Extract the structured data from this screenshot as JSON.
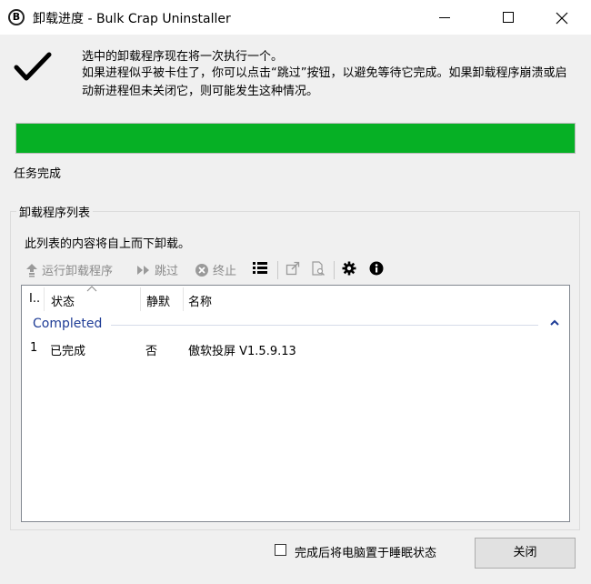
{
  "window": {
    "title": "卸载进度 - Bulk Crap Uninstaller",
    "app_icon_letter": "B"
  },
  "message": {
    "line1": "选中的卸载程序现在将一次执行一个。",
    "line2": "如果进程似乎被卡住了，你可以点击“跳过”按钮，以避免等待它完成。如果卸载程序崩溃或启动新进程但未关闭它，则可能发生这种情况。"
  },
  "progress": {
    "value_percent": 100,
    "status": "任务完成",
    "fill_color": "#06b025"
  },
  "uninstaller_group": {
    "title": "卸载程序列表",
    "description": "此列表的内容将自上而下卸载。",
    "toolbar": {
      "run_label": "运行卸载程序",
      "skip_label": "跳过",
      "stop_label": "终止"
    },
    "columns": {
      "index": "I..",
      "status": "状态",
      "quiet": "静默",
      "name": "名称"
    },
    "groups": [
      {
        "label": "Completed",
        "rows": [
          {
            "index": "1",
            "status": "已完成",
            "quiet": "否",
            "name": "傲软投屏 V1.5.9.13"
          }
        ]
      }
    ]
  },
  "footer": {
    "sleep_label": "完成后将电脑置于睡眠状态",
    "sleep_checked": false,
    "close_label": "关闭"
  }
}
